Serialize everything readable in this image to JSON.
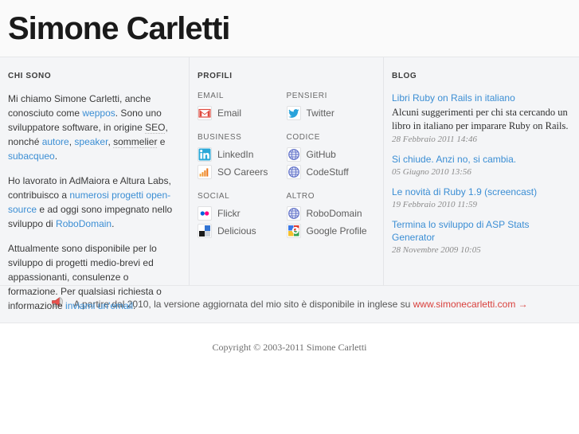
{
  "header": {
    "site_title": "Simone Carletti"
  },
  "about": {
    "heading": "CHI SONO",
    "p1_a": "Mi chiamo Simone Carletti, anche conosciuto come ",
    "p1_link": "weppos",
    "p1_b": ". Sono uno sviluppatore software, in origine ",
    "p1_abbr1": "SEO",
    "p1_c": ", nonché ",
    "p1_link2": "autore",
    "p1_d": ", ",
    "p1_link3": "speaker",
    "p1_e": ", ",
    "p1_abbr2": "sommelier",
    "p1_f": " e ",
    "p1_link4": "subacqueo",
    "p1_g": ".",
    "p2_a": "Ho lavorato in AdMaiora e Altura Labs, contribuisco a ",
    "p2_link": "numerosi progetti open-source",
    "p2_b": " e ad oggi sono impegnato nello sviluppo di ",
    "p2_link2": "RoboDomain",
    "p2_c": ".",
    "p3_a": "Attualmente sono disponibile per lo sviluppo di progetti medio-brevi ed appassionanti, consulenze o formazione. Per qualsiasi richiesta o informazione ",
    "p3_link": "inviami un'email",
    "p3_b": "."
  },
  "profiles": {
    "heading": "PROFILI",
    "groups": [
      {
        "title": "EMAIL",
        "items": [
          {
            "label": "Email",
            "icon": "gmail-icon"
          }
        ]
      },
      {
        "title": "PENSIERI",
        "items": [
          {
            "label": "Twitter",
            "icon": "twitter-icon"
          }
        ]
      },
      {
        "title": "BUSINESS",
        "items": [
          {
            "label": "LinkedIn",
            "icon": "linkedin-icon"
          },
          {
            "label": "SO Careers",
            "icon": "stackoverflow-careers-icon"
          }
        ]
      },
      {
        "title": "CODICE",
        "items": [
          {
            "label": "GitHub",
            "icon": "globe-icon"
          },
          {
            "label": "CodeStuff",
            "icon": "globe-icon"
          }
        ]
      },
      {
        "title": "SOCIAL",
        "items": [
          {
            "label": "Flickr",
            "icon": "flickr-icon"
          },
          {
            "label": "Delicious",
            "icon": "delicious-icon"
          }
        ]
      },
      {
        "title": "ALTRO",
        "items": [
          {
            "label": "RoboDomain",
            "icon": "globe-icon"
          },
          {
            "label": "Google Profile",
            "icon": "google-icon"
          }
        ]
      }
    ]
  },
  "blog": {
    "heading": "BLOG",
    "posts": [
      {
        "title": "Libri Ruby on Rails in italiano",
        "excerpt": "Alcuni suggerimenti per chi sta cercando un libro in italiano per imparare Ruby on Rails.",
        "date": "28 Febbraio 2011 14:46"
      },
      {
        "title": "Si chiude. Anzi no, si cambia.",
        "excerpt": "",
        "date": "05 Giugno 2010 13:56"
      },
      {
        "title": "Le novità di Ruby 1.9 (screencast)",
        "excerpt": "",
        "date": "19 Febbraio 2010 11:59"
      },
      {
        "title": "Termina lo sviluppo di ASP Stats Generator",
        "excerpt": "",
        "date": "28 Novembre 2009 10:05"
      }
    ]
  },
  "notice": {
    "icon": "megaphone-icon",
    "text": "A partire dal 2010, la versione aggiornata del mio sito è disponibile in inglese su ",
    "link": "www.simonecarletti.com →"
  },
  "footer": {
    "copyright": "Copyright © 2003-2011 Simone Carletti"
  },
  "colors": {
    "link": "#3b8ed4",
    "notice_link": "#d9403c",
    "page_bg": "#f4f5f7"
  }
}
